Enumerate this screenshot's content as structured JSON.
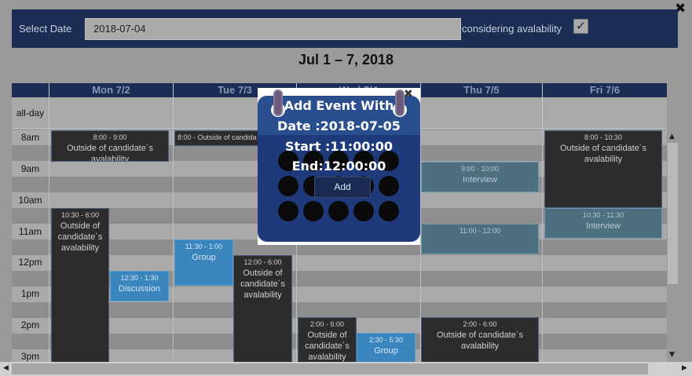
{
  "top_bar": {
    "select_date_label": "Select Date",
    "date_value": "2018-07-04",
    "avalability_label": "considering avalability",
    "avalability_checked": true,
    "check_mark": "✓"
  },
  "close_symbol": "✖",
  "calendar": {
    "title": "Jul 1 – 7, 2018",
    "days": [
      "Mon 7/2",
      "Tue 7/3",
      "Wed 7/4",
      "Thu 7/5",
      "Fri 7/6"
    ],
    "allday_label": "all-day",
    "times": [
      "8am",
      "9am",
      "10am",
      "11am",
      "12pm",
      "1pm",
      "2pm",
      "3pm"
    ]
  },
  "events": [
    {
      "time": "8:00 - 9:00",
      "title": "Outside of candidate´s avalability",
      "style": "dark"
    },
    {
      "time": "8:00 - Outside of candida",
      "title": "",
      "style": "dark"
    },
    {
      "time": "8:00 - 10:30",
      "title": "Outside of candidate´s avalability",
      "style": "dark"
    },
    {
      "time": "9:00 - 10:00",
      "title": "Interview",
      "style": "teal"
    },
    {
      "time": "10:30 - 6:00",
      "title": "Outside of candidate´s avalability",
      "style": "dark"
    },
    {
      "time": "10:30 - 11:30",
      "title": "Interview",
      "style": "teal"
    },
    {
      "time": "11:00 - 12:00",
      "title": "",
      "style": "teal"
    },
    {
      "time": "11:30 - 1:00",
      "title": "Group",
      "style": "blue"
    },
    {
      "time": "12:00 - 6:00",
      "title": "Outside of candidate´s avalability",
      "style": "dark"
    },
    {
      "time": "12:30 - 1:30",
      "title": "Discussion",
      "style": "blue"
    },
    {
      "time": "2:00 - 6:00",
      "title": "Outside of candidate´s avalability",
      "style": "dark"
    },
    {
      "time": "2:30 - 5:30",
      "title": "Group",
      "style": "blue"
    },
    {
      "time": "2:00 - 6:00",
      "title": "Outside of candidate´s avalability",
      "style": "dark"
    }
  ],
  "popup": {
    "heading": "Add Event With",
    "date_line": "Date :2018-07-05",
    "start_line": "Start :11:00:00",
    "end_line": "End:12:00:00",
    "add_label": "Add",
    "close_symbol": "✖"
  },
  "scrollbar": {
    "up": "▲",
    "down": "▼",
    "left": "◀",
    "right": "▶"
  },
  "colors": {
    "header_bg": "#1b2c55",
    "event_dark": "#2c2c2c",
    "event_teal": "#4d6f80",
    "event_blue": "#3b85bf",
    "popup_bg": "#1e3a7a"
  }
}
